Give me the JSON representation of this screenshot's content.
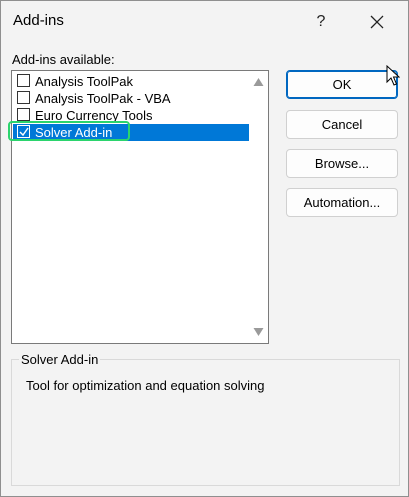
{
  "window": {
    "title": "Add-ins",
    "help_label": "?"
  },
  "list": {
    "label": "Add-ins available:",
    "items": [
      {
        "label": "Analysis ToolPak",
        "checked": false,
        "selected": false
      },
      {
        "label": "Analysis ToolPak - VBA",
        "checked": false,
        "selected": false
      },
      {
        "label": "Euro Currency Tools",
        "checked": false,
        "selected": false
      },
      {
        "label": "Solver Add-in",
        "checked": true,
        "selected": true
      }
    ]
  },
  "buttons": {
    "ok": "OK",
    "cancel": "Cancel",
    "browse": "Browse...",
    "automation": "Automation..."
  },
  "details": {
    "title": "Solver Add-in",
    "description": "Tool for optimization and equation solving"
  },
  "colors": {
    "selection": "#0078d7",
    "highlight_outline": "#2bd46d",
    "default_button_border": "#0067c0"
  }
}
